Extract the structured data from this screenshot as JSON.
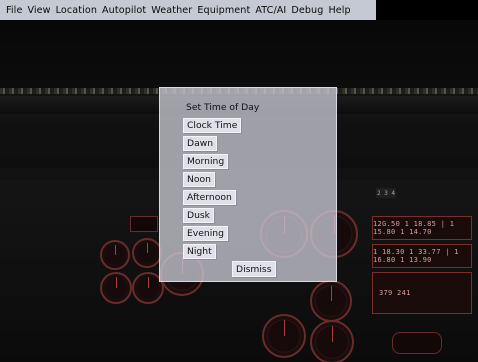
{
  "menu": [
    "File",
    "View",
    "Location",
    "Autopilot",
    "Weather",
    "Equipment",
    "ATC/AI",
    "Debug",
    "Help"
  ],
  "dialog": {
    "title": "Set Time of Day",
    "options": [
      "Clock Time",
      "Dawn",
      "Morning",
      "Noon",
      "Afternoon",
      "Dusk",
      "Evening",
      "Night"
    ],
    "dismiss_label": "Dismiss"
  },
  "cockpit": {
    "radios": [
      "12G.50 1 18.85 | 1 15.80 1 14.70",
      "1 18.30 1 33.77 | 1 16.80 1 13.90",
      "379  241"
    ],
    "small_display": "2 3 4"
  },
  "colors": {
    "instrument": "#6a2c2a",
    "menubar": "#c5c9d3",
    "dialog": "#c8c8d4"
  }
}
